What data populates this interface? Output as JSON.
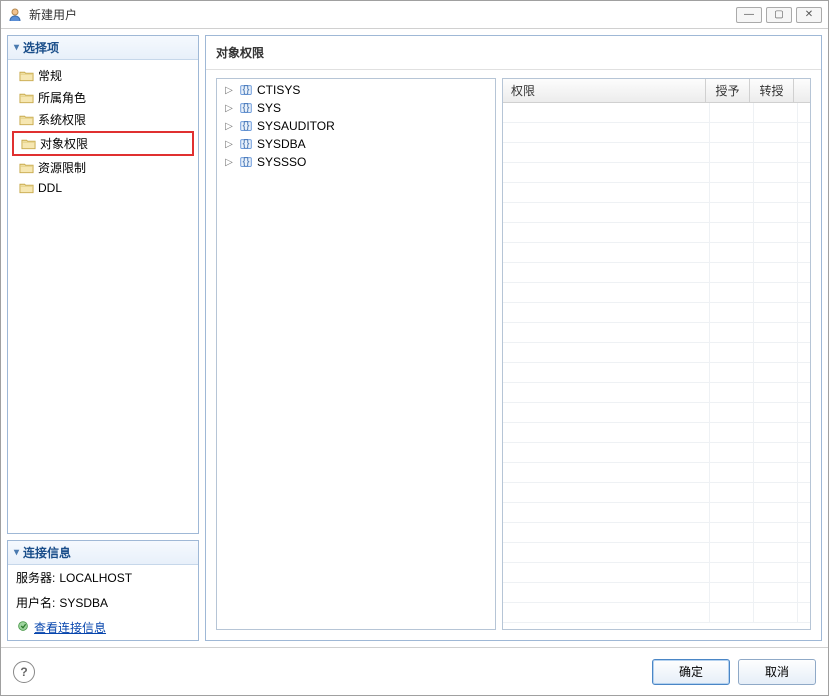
{
  "window": {
    "title": "新建用户"
  },
  "sidebar": {
    "header": "选择项",
    "items": [
      {
        "label": "常规"
      },
      {
        "label": "所属角色"
      },
      {
        "label": "系统权限"
      },
      {
        "label": "对象权限"
      },
      {
        "label": "资源限制"
      },
      {
        "label": "DDL"
      }
    ],
    "selected_index": 3
  },
  "connection": {
    "header": "连接信息",
    "server_label": "服务器:",
    "server_value": "LOCALHOST",
    "user_label": "用户名:",
    "user_value": "SYSDBA",
    "view_link": "查看连接信息"
  },
  "main": {
    "title": "对象权限",
    "tree_items": [
      {
        "label": "CTISYS"
      },
      {
        "label": "SYS"
      },
      {
        "label": "SYSAUDITOR"
      },
      {
        "label": "SYSDBA"
      },
      {
        "label": "SYSSSO"
      }
    ],
    "perm_table": {
      "headers": {
        "perm": "权限",
        "auth": "授予",
        "trans": "转授"
      }
    }
  },
  "footer": {
    "ok": "确定",
    "cancel": "取消"
  }
}
